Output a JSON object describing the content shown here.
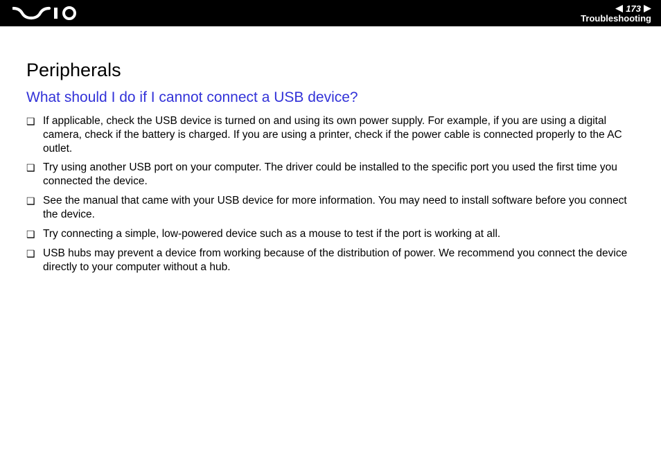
{
  "header": {
    "page_number": "173",
    "section": "Troubleshooting"
  },
  "content": {
    "title": "Peripherals",
    "question": "What should I do if I cannot connect a USB device?",
    "bullets": [
      "If applicable, check the USB device is turned on and using its own power supply. For example, if you are using a digital camera, check if the battery is charged. If you are using a printer, check if the power cable is connected properly to the AC outlet.",
      "Try using another USB port on your computer. The driver could be installed to the specific port you used the first time you connected the device.",
      "See the manual that came with your USB device for more information. You may need to install software before you connect the device.",
      "Try connecting a simple, low-powered device such as a mouse to test if the port is working at all.",
      "USB hubs may prevent a device from working because of the distribution of power. We recommend you connect the device directly to your computer without a hub."
    ]
  }
}
